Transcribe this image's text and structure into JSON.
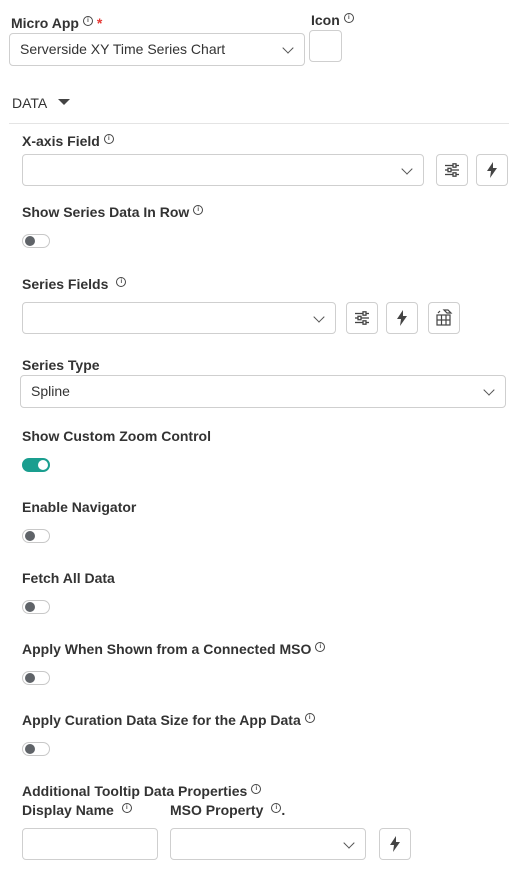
{
  "micro_app": {
    "label": "Micro App",
    "required_mark": "*",
    "selected": "Serverside XY Time Series Chart"
  },
  "icon": {
    "label": "Icon"
  },
  "section": {
    "title": "DATA"
  },
  "x_axis": {
    "label": "X-axis Field",
    "value": ""
  },
  "show_series_row": {
    "label": "Show Series Data In Row",
    "enabled": false
  },
  "series_fields": {
    "label": "Series Fields",
    "value": ""
  },
  "series_type": {
    "label": "Series Type",
    "selected": "Spline"
  },
  "custom_zoom": {
    "label": "Show Custom Zoom Control",
    "enabled": true
  },
  "navigator": {
    "label": "Enable Navigator",
    "enabled": false
  },
  "fetch_all": {
    "label": "Fetch All Data",
    "enabled": false
  },
  "apply_connected": {
    "label": "Apply When Shown from a Connected MSO",
    "enabled": false
  },
  "apply_curation": {
    "label": "Apply Curation Data Size for the App Data",
    "enabled": false
  },
  "tooltip": {
    "label": "Additional Tooltip Data Properties",
    "display_name_label": "Display Name",
    "mso_property_label": "MSO Property",
    "mso_property_suffix": "."
  },
  "info_glyph": "i",
  "colors": {
    "toggle_on": "#1a9e8f",
    "required": "#e53935",
    "border": "#cfcfcf"
  }
}
